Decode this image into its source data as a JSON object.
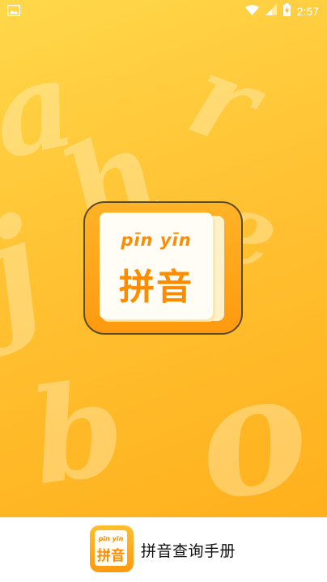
{
  "status_bar": {
    "time": "2:57",
    "icons": [
      "image-notification-icon",
      "wifi-icon",
      "signal-icon",
      "battery-charging-icon"
    ]
  },
  "splash": {
    "logo_pinyin": "pīn yīn",
    "logo_chinese": "拼音",
    "background_letters": [
      "a",
      "h",
      "r",
      "e",
      "j",
      "b",
      "o"
    ]
  },
  "footer": {
    "icon_pinyin": "pīn yīn",
    "icon_chinese": "拼音",
    "app_name": "拼音查询手册"
  },
  "colors": {
    "gradient_top": "#ffd84a",
    "gradient_bottom": "#ffb01c",
    "logo_orange": "#ff8c00",
    "footer_background": "#ffffff"
  }
}
